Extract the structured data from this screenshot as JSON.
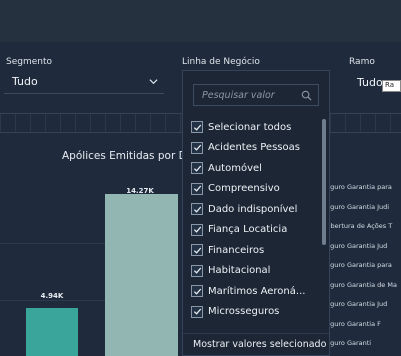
{
  "filters": {
    "segmento": {
      "label": "Segmento",
      "value": "Tudo"
    },
    "linha": {
      "label": "Linha de Negócio"
    },
    "ramo": {
      "label": "Ramo",
      "value": "Tudo",
      "tooltip": "Ra"
    }
  },
  "chart": {
    "title": "Apólices Emitidas por Data de",
    "bar_labels": [
      "14.27K",
      "4.94K"
    ]
  },
  "chart_data": {
    "type": "bar",
    "title": "Apólices Emitidas por Data de",
    "categories": [
      "",
      ""
    ],
    "values": [
      4940,
      14270
    ],
    "data_labels": [
      "4.94K",
      "14.27K"
    ]
  },
  "right_list": [
    "Seguro Garantia para",
    "Seguro Garantia Judi",
    "Cobertura de Ações T",
    "Seguro Garantia Jud",
    "Seguro Garantia para",
    "Seguro Garantia de Ma",
    "Seguro Garantia Jud",
    "Seguro Garantia F",
    "Seguro Garanti"
  ],
  "dropdown": {
    "search_placeholder": "Pesquisar valor",
    "options": [
      {
        "label": "Selecionar todos",
        "checked": true
      },
      {
        "label": "Acidentes Pessoas",
        "checked": true
      },
      {
        "label": "Automóvel",
        "checked": true
      },
      {
        "label": "Compreensivo",
        "checked": true
      },
      {
        "label": "Dado indisponível",
        "checked": true
      },
      {
        "label": "Fiança Locaticia",
        "checked": true
      },
      {
        "label": "Financeiros",
        "checked": true
      },
      {
        "label": "Habitacional",
        "checked": true
      },
      {
        "label": "Marítimos Aeroná...",
        "checked": true
      },
      {
        "label": "Microsseguros",
        "checked": true
      }
    ],
    "footer": "Mostrar valores selecionado"
  },
  "colors": {
    "background": "#1f2b3c",
    "bar_teal": "#3aa59a",
    "bar_light": "#92b7b2",
    "dropdown_bg": "#1c2635"
  }
}
